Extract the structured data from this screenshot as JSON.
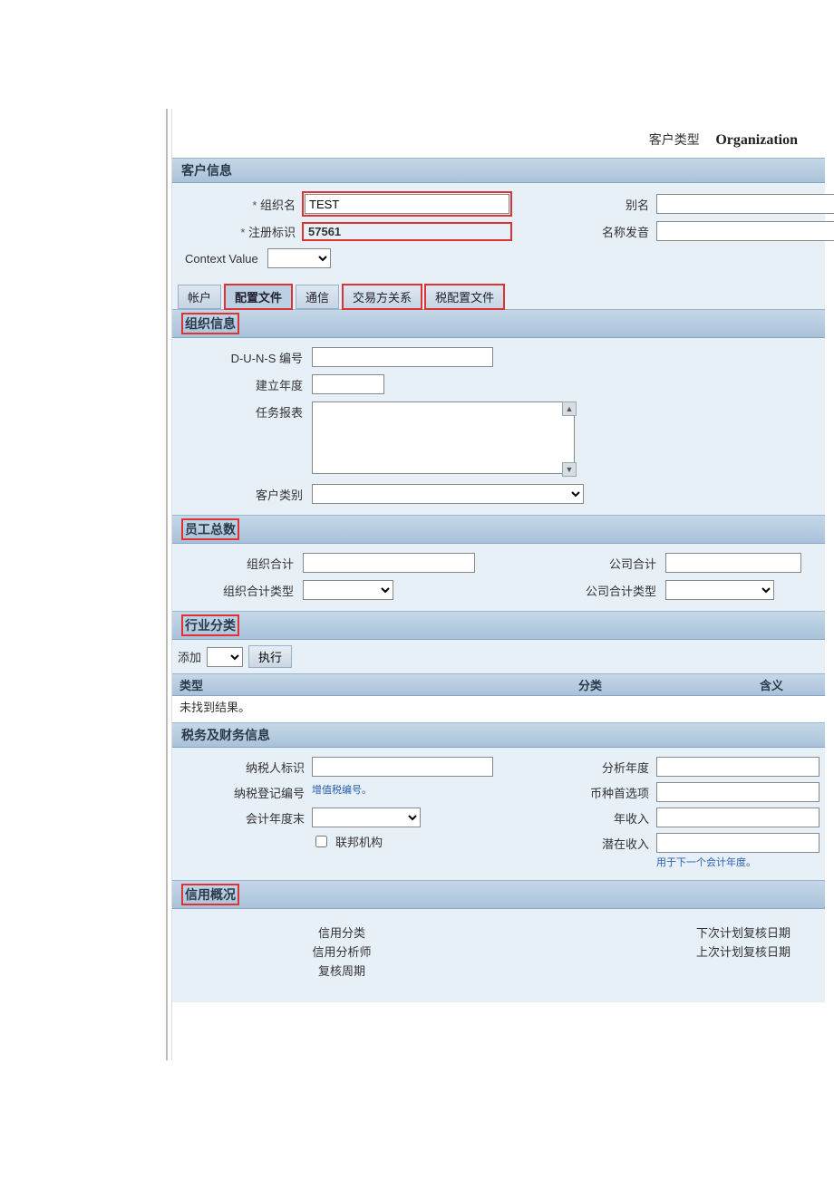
{
  "header": {
    "customer_type_label": "客户类型",
    "customer_type_value": "Organization"
  },
  "sections": {
    "customer_info": {
      "title": "客户信息",
      "org_name_label": "组织名",
      "org_name_value": "TEST",
      "reg_id_label": "注册标识",
      "reg_id_value": "57561",
      "alias_label": "别名",
      "alias_value": "",
      "pronunciation_label": "名称发音",
      "pronunciation_value": "",
      "context_value_label": "Context Value"
    },
    "tabs": {
      "account": "帐户",
      "profile": "配置文件",
      "comm": "通信",
      "counterparty": "交易方关系",
      "tax_profile": "税配置文件"
    },
    "org_info": {
      "title": "组织信息",
      "duns_label": "D-U-N-S 编号",
      "duns_value": "",
      "est_year_label": "建立年度",
      "est_year_value": "",
      "mission_label": "任务报表",
      "mission_value": "",
      "cust_cat_label": "客户类别"
    },
    "employee_total": {
      "title": "员工总数",
      "org_total_label": "组织合计",
      "org_total_value": "",
      "org_total_type_label": "组织合计类型",
      "company_total_label": "公司合计",
      "company_total_value": "",
      "company_total_type_label": "公司合计类型"
    },
    "industry": {
      "title": "行业分类",
      "add_label": "添加",
      "execute_label": "执行",
      "col_type": "类型",
      "col_category": "分类",
      "col_meaning": "含义",
      "no_results": "未找到结果。"
    },
    "tax_fin": {
      "title": "税务及财务信息",
      "taxpayer_id_label": "纳税人标识",
      "taxpayer_id_value": "",
      "tax_reg_no_label": "纳税登记编号",
      "tax_reg_hint": "增值税编号。",
      "fiscal_year_end_label": "会计年度末",
      "federal_agency_label": "联邦机构",
      "analysis_year_label": "分析年度",
      "analysis_year_value": "",
      "currency_pref_label": "币种首选项",
      "currency_pref_value": "",
      "annual_income_label": "年收入",
      "annual_income_value": "",
      "potential_income_label": "潜在收入",
      "potential_income_value": "",
      "potential_income_hint": "用于下一个会计年度。"
    },
    "credit": {
      "title": "信用概况",
      "credit_class_label": "信用分类",
      "credit_analyst_label": "信用分析师",
      "review_cycle_label": "复核周期",
      "next_review_label": "下次计划复核日期",
      "last_review_label": "上次计划复核日期"
    }
  }
}
